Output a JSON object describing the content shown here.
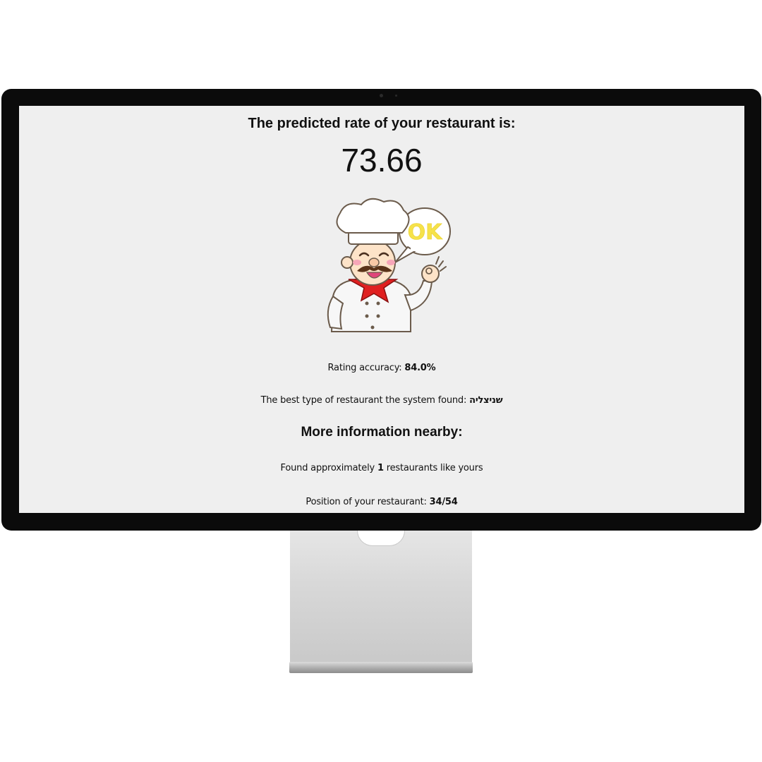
{
  "result": {
    "headline": "The predicted rate of your restaurant is:",
    "score": "73.66",
    "illustration": {
      "name": "chef-ok-icon",
      "bubble_text": "OK"
    },
    "accuracy_label": "Rating accuracy:",
    "accuracy_value": "84.0%",
    "best_type_label": "The best type of restaurant the system found:",
    "best_type_value": "שניצליה"
  },
  "nearby": {
    "title": "More information nearby:",
    "found_prefix": "Found approximately",
    "found_count": "1",
    "found_suffix": "restaurants like yours",
    "position_label": "Position of your restaurant:",
    "position_value": "34/54"
  },
  "colors": {
    "screen_bg": "#efefef",
    "bezel": "#0b0b0b",
    "bubble_text": "#f6e24a",
    "scarf": "#e02020"
  }
}
